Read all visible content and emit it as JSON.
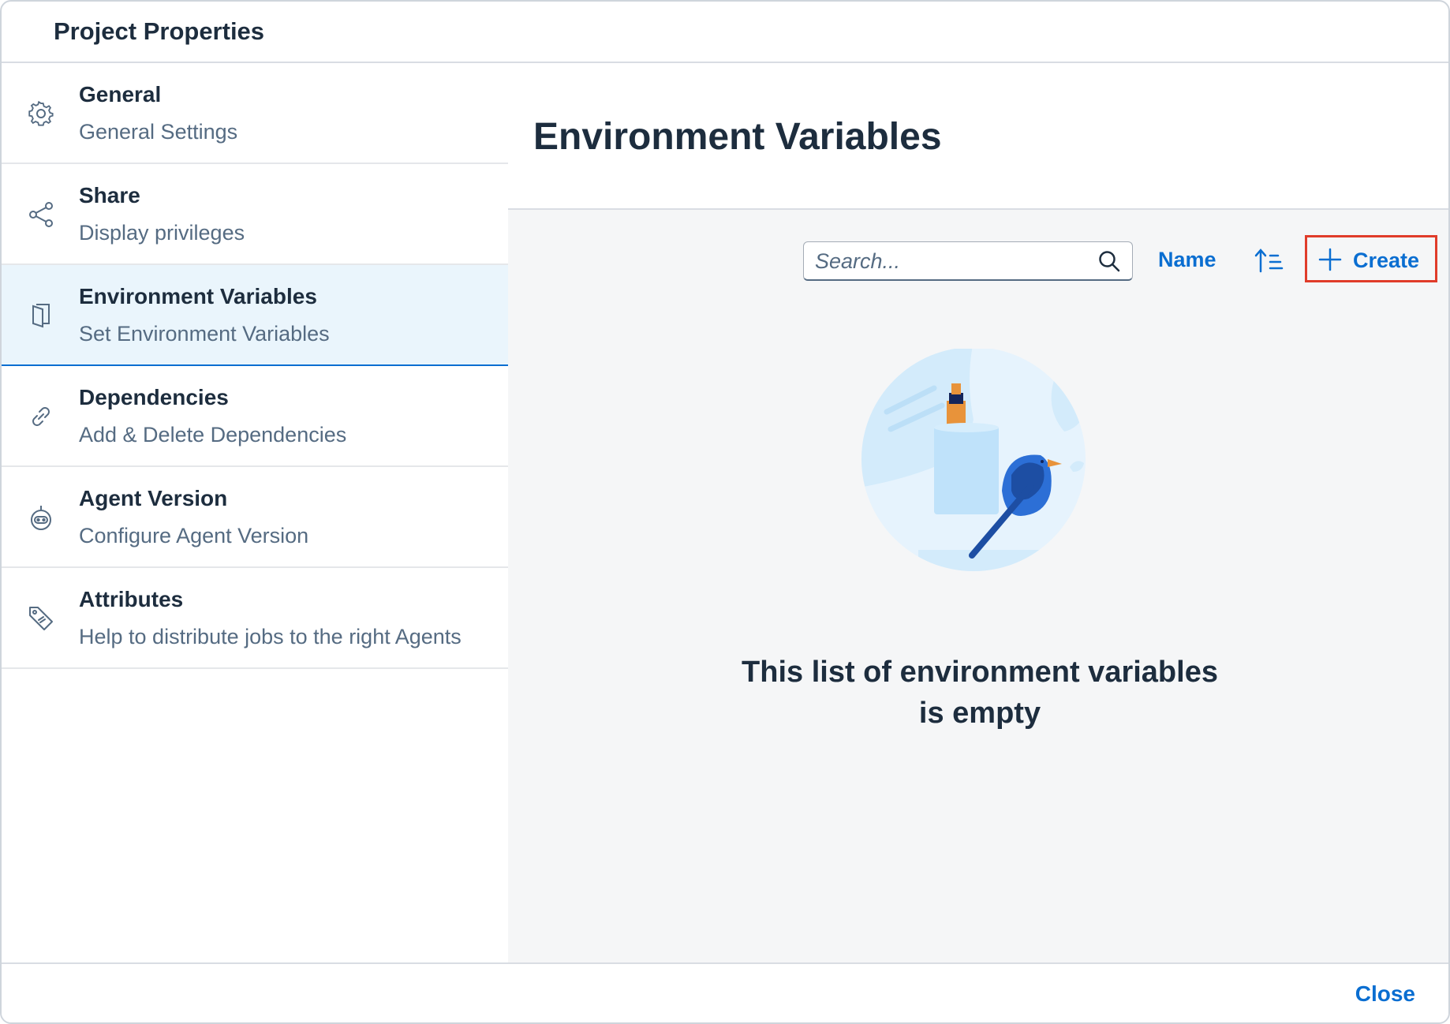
{
  "dialog": {
    "title": "Project Properties"
  },
  "sidebar": {
    "items": [
      {
        "title": "General",
        "subtitle": "General Settings",
        "icon": "gear-icon"
      },
      {
        "title": "Share",
        "subtitle": "Display privileges",
        "icon": "share-icon"
      },
      {
        "title": "Environment Variables",
        "subtitle": "Set Environment Variables",
        "icon": "document-icon",
        "selected": true
      },
      {
        "title": "Dependencies",
        "subtitle": "Add & Delete Dependencies",
        "icon": "link-icon"
      },
      {
        "title": "Agent Version",
        "subtitle": "Configure Agent Version",
        "icon": "robot-icon"
      },
      {
        "title": "Attributes",
        "subtitle": "Help to distribute jobs to the right Agents",
        "icon": "tag-icon"
      }
    ]
  },
  "main": {
    "title": "Environment Variables",
    "toolbar": {
      "search_placeholder": "Search...",
      "sort_label": "Name",
      "create_label": "Create"
    },
    "empty_state": {
      "line1": "This list of environment variables",
      "line2": "is empty"
    }
  },
  "footer": {
    "close_label": "Close"
  },
  "colors": {
    "accent": "#0a6ed1",
    "selected_bg": "#eaf5fc",
    "content_bg": "#f5f6f7",
    "highlight_border": "#e03c2a",
    "text": "#1d2d3e",
    "subtext": "#556b82"
  }
}
